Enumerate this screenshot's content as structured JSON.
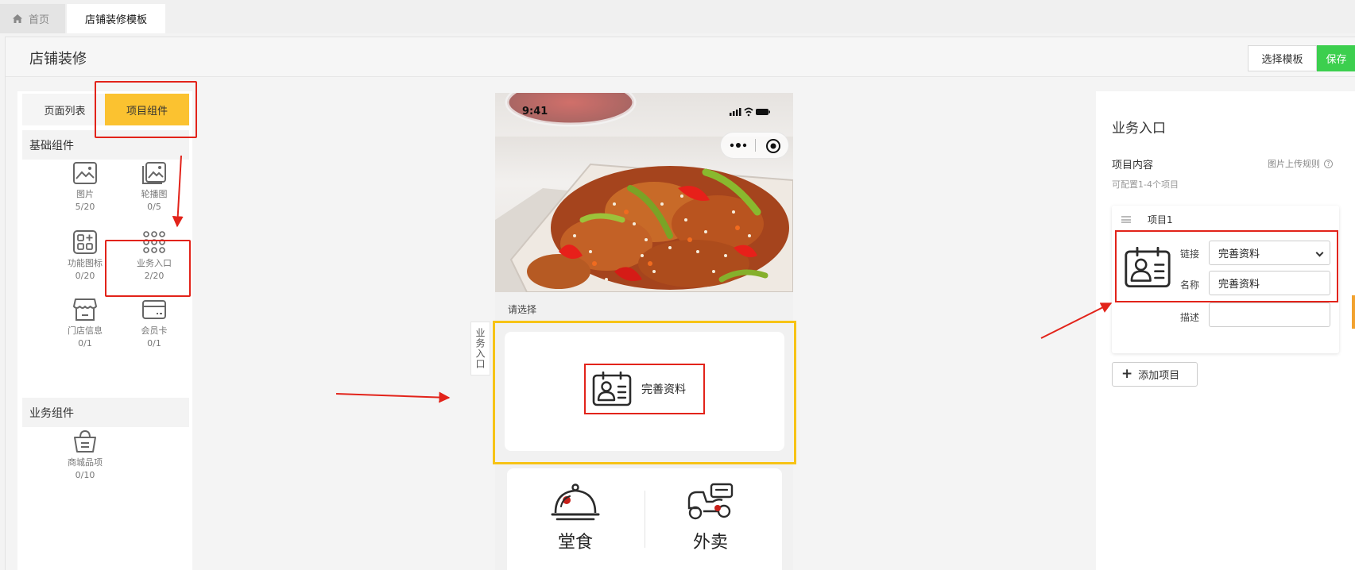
{
  "tabs": {
    "home": "首页",
    "active": "店铺装修模板"
  },
  "page": {
    "title": "店铺装修"
  },
  "toolbar": {
    "choose_template": "选择模板",
    "save": "保存"
  },
  "left_panel": {
    "tabs": [
      "页面列表",
      "项目组件"
    ],
    "basic_section": "基础组件",
    "basic_components": [
      {
        "name": "图片",
        "count": "5/20",
        "icon": "image-icon"
      },
      {
        "name": "轮播图",
        "count": "0/5",
        "icon": "carousel-icon"
      },
      {
        "name": "功能图标",
        "count": "0/20",
        "icon": "function-icon"
      },
      {
        "name": "业务入口",
        "count": "2/20",
        "icon": "grid-icon"
      },
      {
        "name": "门店信息",
        "count": "0/1",
        "icon": "store-icon"
      },
      {
        "name": "会员卡",
        "count": "0/1",
        "icon": "card-icon"
      }
    ],
    "business_section": "业务组件",
    "business_components": [
      {
        "name": "商城品项",
        "count": "0/10",
        "icon": "basket-icon"
      }
    ]
  },
  "preview": {
    "status_time": "9:41",
    "select_label": "请选择",
    "side_label": "业务入口",
    "entry_item": {
      "name": "完善资料",
      "icon": "id-card-icon"
    },
    "services": [
      {
        "name": "堂食",
        "icon": "dining-cloche-icon"
      },
      {
        "name": "外卖",
        "icon": "scooter-icon"
      }
    ],
    "colors": {
      "selection": "#f7c316",
      "annotation": "#e2231a",
      "save": "#3ccf4e",
      "active_tab": "#fbc230"
    }
  },
  "right_panel": {
    "title": "业务入口",
    "section": "项目内容",
    "upload_rule": "图片上传规则",
    "note": "可配置1-4个项目",
    "item": {
      "title": "项目1",
      "link_label": "链接",
      "link_value": "完善资料",
      "name_label": "名称",
      "name_value": "完善资料",
      "desc_label": "描述",
      "desc_value": ""
    },
    "add_button": "添加项目"
  }
}
